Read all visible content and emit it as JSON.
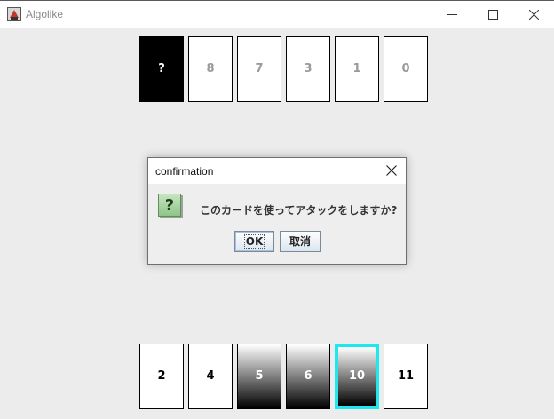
{
  "window": {
    "title": "Algolike",
    "app_icon": "algolike-app-icon",
    "controls": [
      "minimize-icon",
      "maximize-icon",
      "close-icon"
    ]
  },
  "opponent_hand": {
    "cards": [
      {
        "label": "?",
        "style": "hidden"
      },
      {
        "label": "8",
        "style": "opp-open"
      },
      {
        "label": "7",
        "style": "opp-open"
      },
      {
        "label": "3",
        "style": "opp-open"
      },
      {
        "label": "1",
        "style": "opp-open"
      },
      {
        "label": "0",
        "style": "opp-open"
      }
    ]
  },
  "player_hand": {
    "cards": [
      {
        "label": "2",
        "style": "white"
      },
      {
        "label": "4",
        "style": "white"
      },
      {
        "label": "5",
        "style": "black"
      },
      {
        "label": "6",
        "style": "black"
      },
      {
        "label": "10",
        "style": "black",
        "selected": true
      },
      {
        "label": "11",
        "style": "white"
      }
    ]
  },
  "dialog": {
    "title": "confirmation",
    "icon": "question-icon",
    "icon_glyph": "?",
    "message": "このカードを使ってアタックをしますか?",
    "ok_label": "OK",
    "cancel_label": "取消"
  },
  "colors": {
    "selected_border": "#1ee8ee",
    "background": "#ececec"
  }
}
